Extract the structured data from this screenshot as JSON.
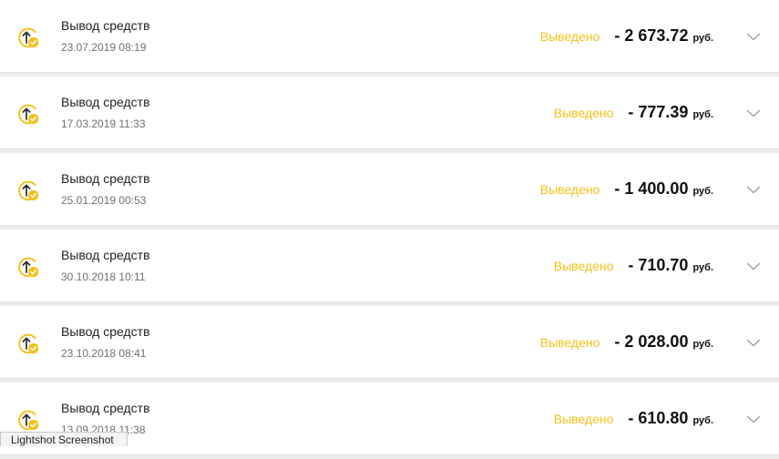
{
  "colors": {
    "status": "#f2c11a",
    "amount": "#111111",
    "icon": "#f2c11a"
  },
  "transactions": [
    {
      "title": "Вывод средств",
      "date": "23.07.2019 08:19",
      "status": "Выведено",
      "amount": "- 2 673.72",
      "currency": "руб.",
      "icon": "withdraw-up-arrow-check-icon"
    },
    {
      "title": "Вывод средств",
      "date": "17.03.2019 11:33",
      "status": "Выведено",
      "amount": "- 777.39",
      "currency": "руб.",
      "icon": "withdraw-up-arrow-check-icon"
    },
    {
      "title": "Вывод средств",
      "date": "25.01.2019 00:53",
      "status": "Выведено",
      "amount": "- 1 400.00",
      "currency": "руб.",
      "icon": "withdraw-up-arrow-check-icon"
    },
    {
      "title": "Вывод средств",
      "date": "30.10.2018 10:11",
      "status": "Выведено",
      "amount": "- 710.70",
      "currency": "руб.",
      "icon": "withdraw-up-arrow-check-icon"
    },
    {
      "title": "Вывод средств",
      "date": "23.10.2018 08:41",
      "status": "Выведено",
      "amount": "- 2 028.00",
      "currency": "руб.",
      "icon": "withdraw-up-arrow-check-icon"
    },
    {
      "title": "Вывод средств",
      "date": "13.09.2018 11:38",
      "status": "Выведено",
      "amount": "- 610.80",
      "currency": "руб.",
      "icon": "withdraw-up-arrow-check-icon"
    }
  ],
  "watermark": {
    "text": "Lightshot Screenshot"
  }
}
